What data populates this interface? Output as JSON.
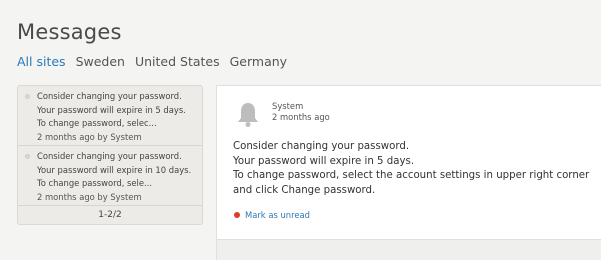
{
  "page": {
    "title": "Messages"
  },
  "tabs": [
    {
      "label": "All sites",
      "active": true
    },
    {
      "label": "Sweden",
      "active": false
    },
    {
      "label": "United States",
      "active": false
    },
    {
      "label": "Germany",
      "active": false
    }
  ],
  "messages": [
    {
      "snippet": "Consider changing your password. Your password will expire in 5 days. To change password, selec...",
      "meta": "2 months ago by System"
    },
    {
      "snippet": "Consider changing your password. Your password will expire in 10 days. To change password, sele...",
      "meta": "2 months ago by System"
    }
  ],
  "pager": {
    "label": "1-2/2"
  },
  "detail": {
    "sender": "System",
    "time": "2 months ago",
    "lines": [
      "Consider changing your password.",
      "Your password will expire in 5 days.",
      "To change password, select the account settings in upper right corner and click Change password."
    ],
    "mark_unread_label": "Mark as unread",
    "icon": "bell-icon"
  },
  "colors": {
    "accent": "#2a7ab8",
    "unread_dot": "#e03a2f"
  }
}
